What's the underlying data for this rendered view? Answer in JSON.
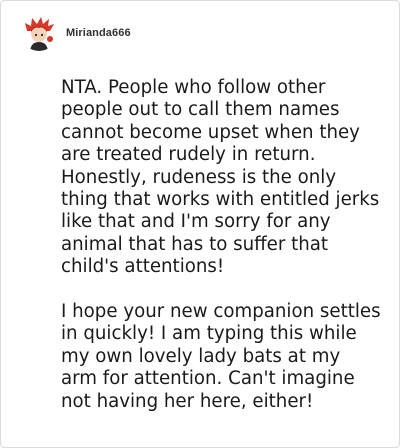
{
  "comment": {
    "username": "Mirianda666",
    "avatar_icon": "red-haired-cartoon-avatar",
    "paragraphs": [
      "NTA. People who follow other people out to call them names cannot become upset when they are treated rudely in return. Honestly, rudeness is the only thing that works with entitled jerks like that and I'm sorry for any animal that has to suffer that child's attentions!",
      "I hope your new companion settles in quickly! I am typing this while my own lovely lady bats at my arm for attention. Can't imagine not having her here, either!"
    ]
  }
}
